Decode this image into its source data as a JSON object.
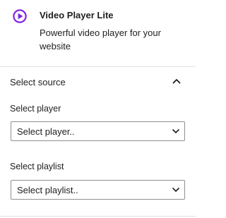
{
  "block": {
    "icon": "play-circle-icon",
    "title": "Video Player Lite",
    "description": "Powerful video player for your website"
  },
  "panel": {
    "title": "Select source",
    "toggle_icon": "chevron-up-icon",
    "fields": [
      {
        "label": "Select player",
        "value": "Select player.."
      },
      {
        "label": "Select playlist",
        "value": "Select playlist.."
      }
    ]
  },
  "colors": {
    "accent": "#8224e3",
    "text": "#1e1e1e",
    "divider": "#e0e0e0",
    "input_border": "#8c8f94"
  }
}
